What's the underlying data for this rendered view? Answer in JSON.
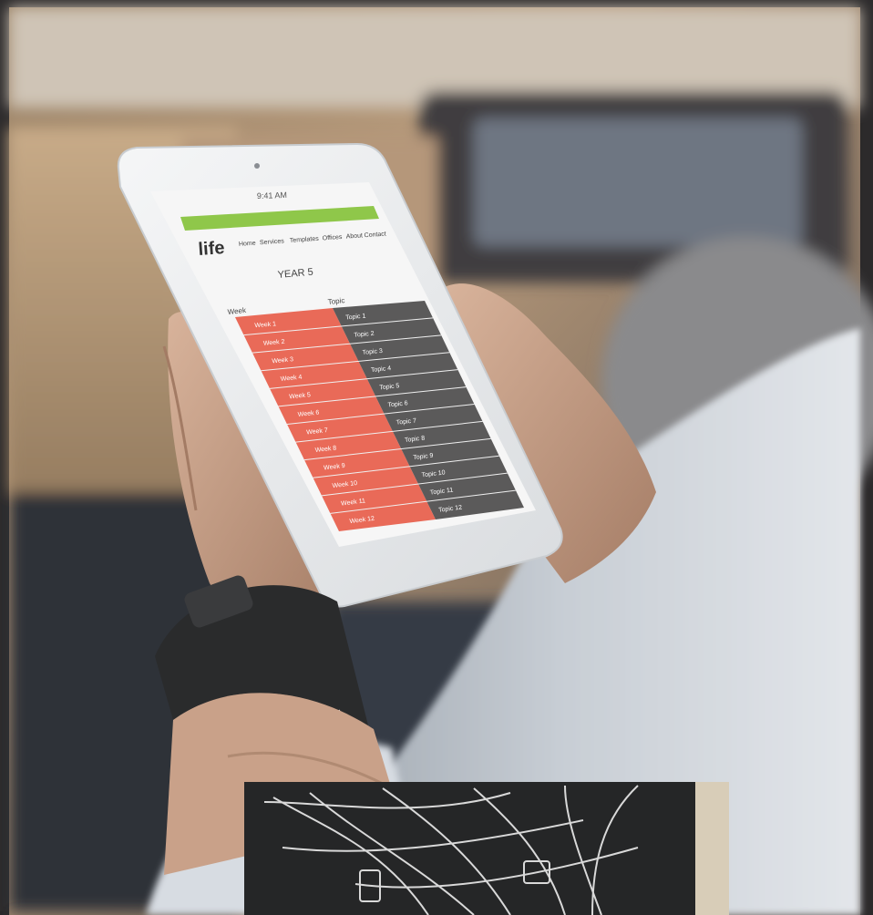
{
  "photo": {
    "subject": "hands holding tablet",
    "colors": {
      "background_warm": "#a88b6d",
      "background_dark": "#3c3a3b",
      "frame_border": "#2c2a2b",
      "tablet_body": "#eceef0",
      "screen_bg": "#f6f6f6",
      "green_bar": "#8fc74a",
      "red_column": "#e96a58",
      "gray_column": "#5b5a5a",
      "skin": "#c9a189",
      "watch": "#2a2b2c",
      "book_cover": "#252627",
      "book_pages": "#d8cdb8",
      "book_line_art": "#d9d9d9"
    }
  },
  "tablet_screen": {
    "status_time": "9:41 AM",
    "logo_text": "life",
    "nav_items": [
      "Home",
      "Services",
      "Templates",
      "Offices",
      "About",
      "Contact"
    ],
    "page_heading": "YEAR 5",
    "col_left_header": "Week",
    "col_right_header": "Topic",
    "rows": [
      {
        "left": "Week 1",
        "right": "Topic 1"
      },
      {
        "left": "Week 2",
        "right": "Topic 2"
      },
      {
        "left": "Week 3",
        "right": "Topic 3"
      },
      {
        "left": "Week 4",
        "right": "Topic 4"
      },
      {
        "left": "Week 5",
        "right": "Topic 5"
      },
      {
        "left": "Week 6",
        "right": "Topic 6"
      },
      {
        "left": "Week 7",
        "right": "Topic 7"
      },
      {
        "left": "Week 8",
        "right": "Topic 8"
      },
      {
        "left": "Week 9",
        "right": "Topic 9"
      },
      {
        "left": "Week 10",
        "right": "Topic 10"
      },
      {
        "left": "Week 11",
        "right": "Topic 11"
      },
      {
        "left": "Week 12",
        "right": "Topic 12"
      }
    ]
  }
}
